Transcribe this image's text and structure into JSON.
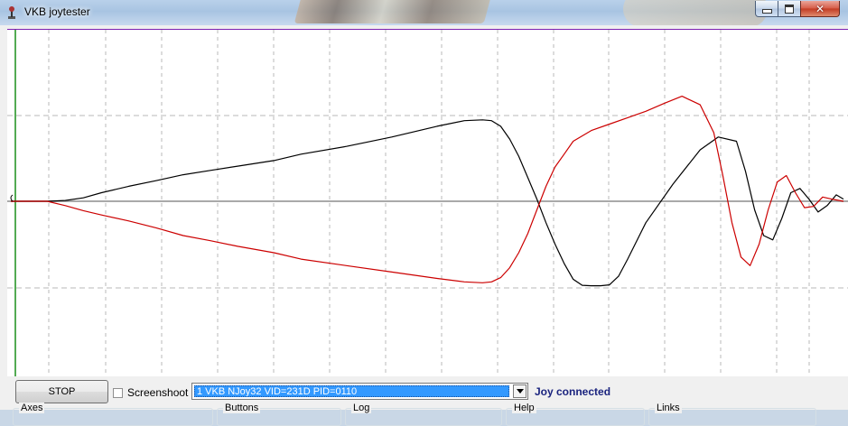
{
  "window": {
    "title": "VKB joytester",
    "icon": "joystick-icon",
    "controls": {
      "minimize": "minimize-icon",
      "maximize": "maximize-icon",
      "close": "close-icon"
    }
  },
  "chart_data": {
    "type": "line",
    "title": "",
    "xlabel": "",
    "ylabel": "",
    "grid": true,
    "series": [
      {
        "color": "#000000",
        "x": [
          0,
          40,
          60,
          80,
          100,
          130,
          160,
          190,
          220,
          250,
          290,
          320,
          370,
          420,
          470,
          500,
          520,
          530,
          540,
          550,
          560,
          570,
          580,
          590,
          600,
          610,
          620,
          630,
          640,
          650,
          660,
          670,
          680,
          700,
          730,
          760,
          780,
          800,
          810,
          820,
          830,
          840,
          850,
          860,
          870,
          880,
          890,
          900,
          910,
          918
        ],
        "y": [
          0,
          0,
          0.02,
          0.08,
          0.2,
          0.35,
          0.48,
          0.62,
          0.72,
          0.82,
          0.95,
          1.1,
          1.28,
          1.5,
          1.75,
          1.88,
          1.9,
          1.88,
          1.75,
          1.45,
          1.05,
          0.55,
          0.05,
          -0.5,
          -1.0,
          -1.45,
          -1.82,
          -1.96,
          -1.97,
          -1.97,
          -1.95,
          -1.75,
          -1.35,
          -0.5,
          0.4,
          1.2,
          1.5,
          1.4,
          0.7,
          -0.2,
          -0.8,
          -0.9,
          -0.4,
          0.2,
          0.3,
          0.05,
          -0.25,
          -0.1,
          0.15,
          0.05
        ]
      },
      {
        "color": "#cc0000",
        "x": [
          0,
          40,
          60,
          80,
          100,
          130,
          160,
          190,
          220,
          250,
          290,
          320,
          370,
          420,
          470,
          500,
          520,
          530,
          540,
          550,
          560,
          570,
          580,
          590,
          600,
          610,
          620,
          640,
          660,
          680,
          700,
          720,
          740,
          760,
          775,
          785,
          795,
          805,
          815,
          825,
          835,
          845,
          855,
          865,
          875,
          885,
          895,
          905,
          918
        ],
        "y": [
          0,
          0,
          -0.1,
          -0.22,
          -0.32,
          -0.46,
          -0.62,
          -0.8,
          -0.92,
          -1.05,
          -1.2,
          -1.35,
          -1.5,
          -1.65,
          -1.8,
          -1.88,
          -1.9,
          -1.88,
          -1.78,
          -1.55,
          -1.2,
          -0.75,
          -0.2,
          0.35,
          0.8,
          1.1,
          1.4,
          1.65,
          1.8,
          1.95,
          2.1,
          2.28,
          2.45,
          2.25,
          1.6,
          0.6,
          -0.5,
          -1.3,
          -1.5,
          -1.0,
          -0.2,
          0.45,
          0.6,
          0.2,
          -0.15,
          -0.12,
          0.1,
          0.05,
          0.0
        ]
      }
    ],
    "xlim": [
      0,
      918
    ],
    "ylim": [
      -2.4,
      2.4
    ]
  },
  "controls": {
    "stop_label": "STOP",
    "screenshot_label": "Screenshoot",
    "screenshot_checked": false,
    "device_selected": "1 VKB NJoy32  VID=231D PID=0110",
    "status": "Joy connected"
  },
  "groups": [
    "Axes",
    "Buttons",
    "Log",
    "Help",
    "Links"
  ]
}
